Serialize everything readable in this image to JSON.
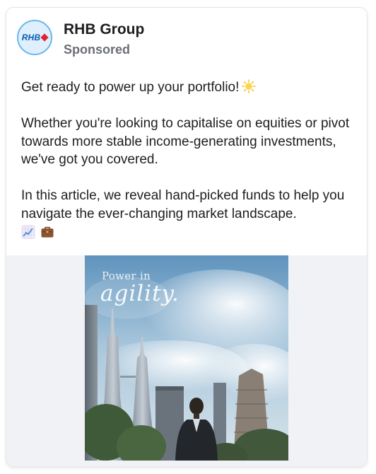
{
  "page": {
    "name": "RHB Group",
    "subtitle": "Sponsored",
    "avatar_text": "RHB"
  },
  "post": {
    "paragraph_1": "Get ready to power up your portfolio!",
    "paragraph_2": "Whether you're looking to capitalise on equities or pivot towards more stable income-generating investments, we've got you covered.",
    "paragraph_3": "In this article, we reveal hand-picked funds to help you navigate the ever-changing market landscape.",
    "emoji_1": "sun-icon",
    "emoji_2": "chart-increasing-icon",
    "emoji_3": "briefcase-icon"
  },
  "ad_image": {
    "line_1": "Power in",
    "line_2": "agility."
  },
  "colors": {
    "brand_blue": "#0a5bb5",
    "brand_red": "#e0242e",
    "sky_top": "#6fa0c8",
    "media_bg": "#f0f2f5"
  }
}
